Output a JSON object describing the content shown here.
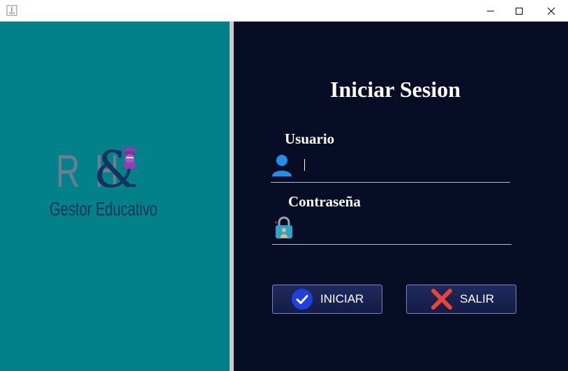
{
  "window": {
    "minimize_glyph": "—",
    "close_glyph": "✕"
  },
  "logo": {
    "letters": "R H",
    "ampersand": "&",
    "subtitle": "Gestor Educativo"
  },
  "login": {
    "title": "Iniciar Sesion",
    "user_label": "Usuario",
    "user_value": "",
    "password_label": "Contraseña",
    "password_value": ""
  },
  "buttons": {
    "login_label": "INICIAR",
    "exit_label": "SALIR"
  },
  "colors": {
    "left_panel": "#02818a",
    "right_panel": "#080d26",
    "button_bg": "#1a2352",
    "check_icon": "#1f3fe0",
    "close_icon": "#e8443a"
  },
  "icons": {
    "app": "java-icon",
    "user": "user-icon",
    "lock": "lock-icon",
    "login": "check-circle-icon",
    "exit": "x-icon"
  }
}
